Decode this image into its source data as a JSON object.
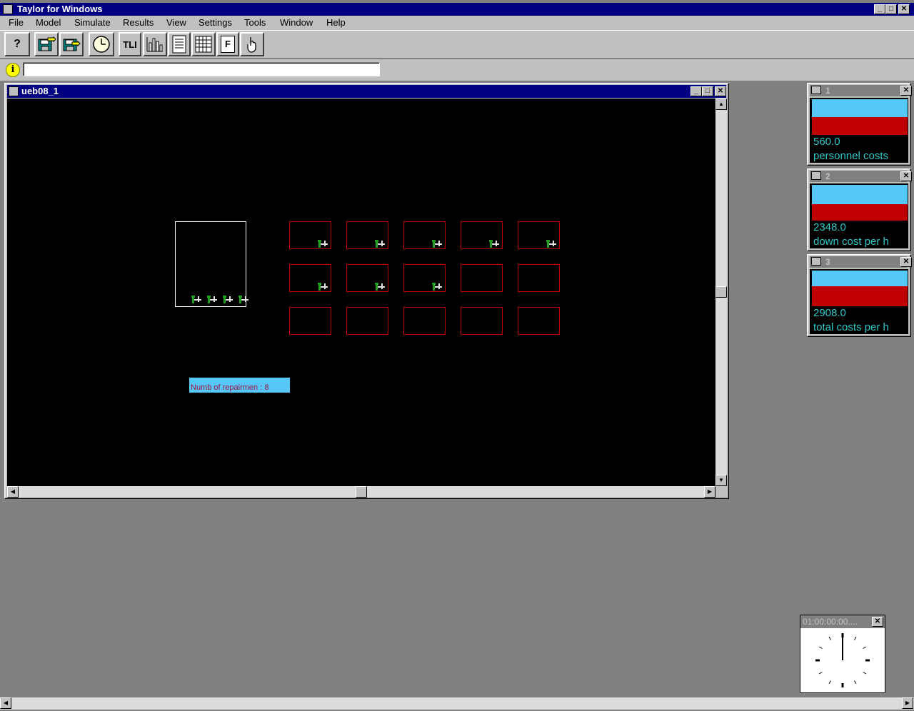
{
  "app": {
    "title": "Taylor for Windows"
  },
  "menu": [
    {
      "label": "File"
    },
    {
      "label": "Model"
    },
    {
      "label": "Simulate"
    },
    {
      "label": "Results"
    },
    {
      "label": "View"
    },
    {
      "label": "Settings"
    },
    {
      "label": "Tools"
    },
    {
      "label": "Window"
    },
    {
      "label": "Help"
    }
  ],
  "toolbar": {
    "help_label": "?",
    "tli_label": "TLI",
    "f_label": "F"
  },
  "info": {
    "text": ""
  },
  "model_window": {
    "title": "ueb08_1",
    "repairmen_label": "Numb of repairmen : 8",
    "machines": [
      {
        "busy": true
      },
      {
        "busy": true
      },
      {
        "busy": true
      },
      {
        "busy": true
      },
      {
        "busy": true
      },
      {
        "busy": true
      },
      {
        "busy": true
      },
      {
        "busy": true
      },
      {
        "busy": false
      },
      {
        "busy": false
      },
      {
        "busy": false
      },
      {
        "busy": false
      },
      {
        "busy": false
      },
      {
        "busy": false
      },
      {
        "busy": false
      }
    ],
    "queue_count": 4
  },
  "stats": [
    {
      "id": "1",
      "value": "560.0",
      "label": "personnel costs",
      "red_fraction": 0.5
    },
    {
      "id": "2",
      "value": "2348.0",
      "label": "down cost per h",
      "red_fraction": 0.46
    },
    {
      "id": "3",
      "value": "2908.0",
      "label": "total costs per h",
      "red_fraction": 0.55
    }
  ],
  "clock": {
    "time": "01:00:00:00...."
  },
  "colors": {
    "titlebar": "#000080",
    "machine_border": "#c00000",
    "stat_blue": "#55c8f8",
    "stat_red": "#c00000",
    "stat_text": "#2ec8c8"
  }
}
